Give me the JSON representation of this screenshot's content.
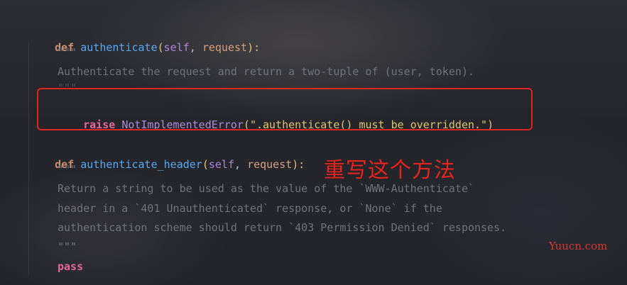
{
  "code": {
    "line1": {
      "kw": "def",
      "fn": "authenticate",
      "open": "(",
      "self": "self",
      "sep": ", ",
      "param": "request",
      "close": "):"
    },
    "line2": "\"\"\"",
    "line3": "Authenticate the request and return a two-tuple of (user, token).",
    "line4": "\"\"\"",
    "line5": {
      "kw": "raise",
      "cls": "NotImplementedError",
      "open": "(",
      "str": "\".authenticate() must be overridden.\"",
      "close": ")"
    },
    "line6": {
      "kw": "def",
      "fn": "authenticate_header",
      "open": "(",
      "self": "self",
      "sep": ", ",
      "param": "request",
      "close": "):"
    },
    "line7": "\"\"\"",
    "line8": "Return a string to be used as the value of the `WWW-Authenticate`",
    "line9": "header in a `401 Unauthenticated` response, or `None` if the",
    "line10": "authentication scheme should return `403 Permission Denied` responses.",
    "line11": "\"\"\"",
    "line12": "pass"
  },
  "annotation": "重写这个方法",
  "watermark": "Yuucn.com",
  "colors": {
    "highlight_border": "#e0251f",
    "annotation": "#e8231c",
    "keyword": "#cf8e6d",
    "function": "#56a8f5",
    "docstring": "#6f737a",
    "string": "#e0c46c"
  }
}
